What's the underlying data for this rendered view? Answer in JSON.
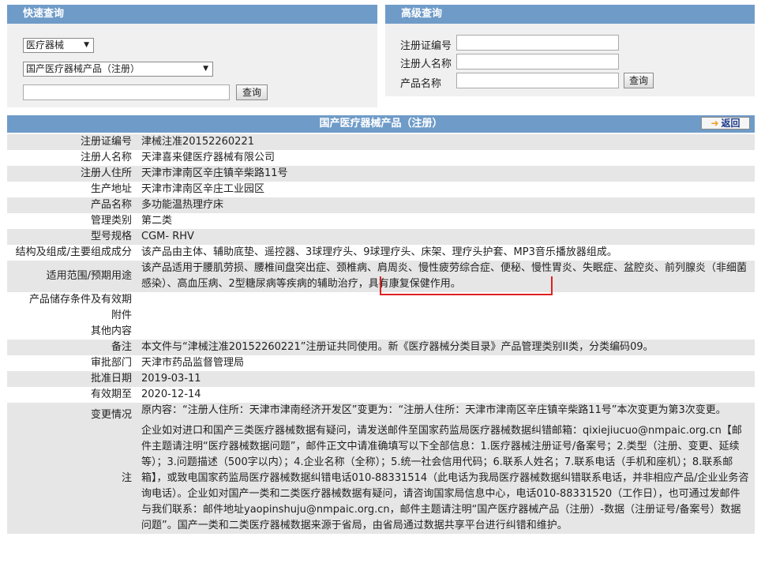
{
  "quick": {
    "title": "快速查询",
    "category_select": "医疗器械",
    "type_select": "国产医疗器械产品（注册）",
    "keyword_value": "",
    "search_label": "查询"
  },
  "advanced": {
    "title": "高级查询",
    "reg_no_label": "注册证编号",
    "registrant_label": "注册人名称",
    "product_label": "产品名称",
    "search_label": "查询"
  },
  "result": {
    "title": "国产医疗器械产品（注册）",
    "back_label": "返回",
    "rows": [
      {
        "label": "注册证编号",
        "value": "津械注准20152260221"
      },
      {
        "label": "注册人名称",
        "value": "天津喜来健医疗器械有限公司"
      },
      {
        "label": "注册人住所",
        "value": "天津市津南区辛庄镇辛柴路11号"
      },
      {
        "label": "生产地址",
        "value": "天津市津南区辛庄工业园区"
      },
      {
        "label": "产品名称",
        "value": "多功能温热理疗床"
      },
      {
        "label": "管理类别",
        "value": "第二类"
      },
      {
        "label": "型号规格",
        "value": "CGM- RHV"
      },
      {
        "label": "结构及组成/主要组成成分",
        "value": "该产品由主体、辅助底垫、遥控器、3球理疗头、9球理疗头、床架、理疗头护套、MP3音乐播放器组成。"
      },
      {
        "label": "适用范围/预期用途",
        "value": "该产品适用于腰肌劳损、腰椎间盘突出症、颈椎病、肩周炎、慢性疲劳综合症、便秘、慢性胃炎、失眠症、盆腔炎、前列腺炎（非细菌感染）、高血压病、2型糖尿病等疾病的辅助治疗，具有康复保健作用。"
      },
      {
        "label": "产品储存条件及有效期",
        "value": ""
      },
      {
        "label": "附件",
        "value": ""
      },
      {
        "label": "其他内容",
        "value": ""
      },
      {
        "label": "备注",
        "value": "本文件与“津械注准20152260221”注册证共同使用。新《医疗器械分类目录》产品管理类别II类，分类编码09。"
      },
      {
        "label": "审批部门",
        "value": "天津市药品监督管理局"
      },
      {
        "label": "批准日期",
        "value": "2019-03-11"
      },
      {
        "label": "有效期至",
        "value": "2020-12-14"
      },
      {
        "label": "变更情况",
        "value": "原内容：“注册人住所：天津市津南经济开发区”变更为：“注册人住所：天津市津南区辛庄镇辛柴路11号”本次变更为第3次变更。"
      },
      {
        "label": "注",
        "value": "企业如对进口和国产三类医疗器械数据有疑问，请发送邮件至国家药监局医疗器械数据纠错邮箱：qixiejiucuo@nmpaic.org.cn【邮件主题请注明“医疗器械数据问题”，邮件正文中请准确填写以下全部信息：1.医疗器械注册证号/备案号；2.类型（注册、变更、延续等）；3.问题描述（500字以内）；4.企业名称（全称）；5.统一社会信用代码；6.联系人姓名；7.联系电话（手机和座机）；8.联系邮箱】，或致电国家药监局医疗器械数据纠错电话010-88331514（此电话为我局医疗器械数据纠错联系电话，并非相应产品/企业业务咨询电话）。企业如对国产一类和二类医疗器械数据有疑问，请咨询国家局信息中心，电话010-88331520（工作日），也可通过发邮件与我们联系：邮件地址yaopinshuju@nmpaic.org.cn，邮件主题请注明“国产医疗器械产品（注册）-数据（注册证号/备案号）数据问题”。国产一类和二类医疗器械数据来源于省局，由省局通过数据共享平台进行纠错和维护。"
      }
    ]
  },
  "colors": {
    "header_blue": "#6f9bc8",
    "row_gray": "#e6e6e6",
    "annotation_red": "#e02020",
    "back_arrow": "#f0a020"
  }
}
